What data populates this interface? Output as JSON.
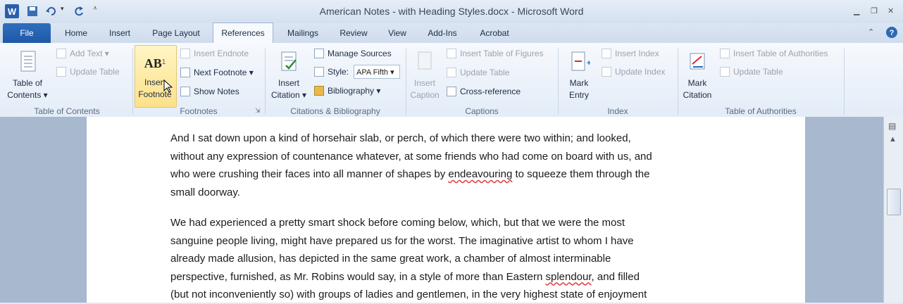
{
  "window": {
    "title": "American Notes - with Heading Styles.docx  -  Microsoft Word"
  },
  "tabs": [
    "File",
    "Home",
    "Insert",
    "Page Layout",
    "References",
    "Mailings",
    "Review",
    "View",
    "Add-Ins",
    "Acrobat"
  ],
  "active_tab": "References",
  "ribbon": {
    "toc": {
      "big": [
        "Table of",
        "Contents ▾"
      ],
      "add_text": "Add Text ▾",
      "update_table": "Update Table",
      "label": "Table of Contents"
    },
    "footnotes": {
      "big_icon": "AB",
      "big": [
        "Insert",
        "Footnote"
      ],
      "insert_endnote": "Insert Endnote",
      "next_footnote": "Next Footnote ▾",
      "show_notes": "Show Notes",
      "label": "Footnotes"
    },
    "citations": {
      "big": [
        "Insert",
        "Citation ▾"
      ],
      "manage_sources": "Manage Sources",
      "style_label": "Style:",
      "style_value": "APA Fifth ▾",
      "bibliography": "Bibliography ▾",
      "label": "Citations & Bibliography"
    },
    "captions": {
      "big": [
        "Insert",
        "Caption"
      ],
      "table_of_figures": "Insert Table of Figures",
      "update_table": "Update Table",
      "cross_reference": "Cross-reference",
      "label": "Captions"
    },
    "index": {
      "big": [
        "Mark",
        "Entry"
      ],
      "insert_index": "Insert Index",
      "update_index": "Update Index",
      "label": "Index"
    },
    "authorities": {
      "big": [
        "Mark",
        "Citation"
      ],
      "insert_toa": "Insert Table of Authorities",
      "update_table": "Update Table",
      "label": "Table of Authorities"
    }
  },
  "document": {
    "para1": [
      "And I sat down upon a kind of horsehair slab, or perch, of which there were two within; and looked,",
      "without any expression of countenance whatever, at some friends who had come on board with us, and",
      "who were crushing their faces into all manner of shapes by ",
      "endeavouring",
      " to squeeze them through the",
      "small doorway."
    ],
    "para2": [
      "We had experienced a pretty smart shock before coming below, which, but that we were the most",
      "sanguine people living, might have prepared us for the worst. The imaginative artist to whom I have",
      "already made allusion, has depicted in the same great work, a chamber of almost interminable",
      "perspective, furnished, as Mr. Robins would say, in a style of more than Eastern ",
      "splendour",
      ", and filled",
      "(but not inconveniently so) with groups of ladies and gentlemen, in the very highest state of enjoyment"
    ]
  },
  "colors": {
    "file_tab": "#2f6fbd",
    "highlight": "#fde08a",
    "ribbon_bg": "#eef3fa"
  }
}
